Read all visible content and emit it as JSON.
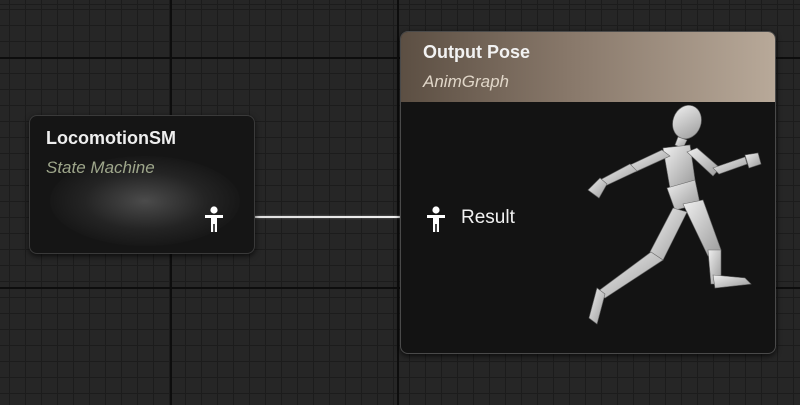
{
  "graph": {
    "grid_color": "#1c1c1c",
    "background_color": "#262626"
  },
  "nodes": {
    "locomotion": {
      "title": "LocomotionSM",
      "subtitle": "State Machine",
      "output_pin_icon": "pose-pin-icon"
    },
    "output_pose": {
      "title": "Output Pose",
      "subtitle": "AnimGraph",
      "input_pin_label": "Result",
      "input_pin_icon": "pose-pin-icon",
      "preview_icon": "running-mannequin-icon",
      "header_color": "#88786a"
    }
  }
}
